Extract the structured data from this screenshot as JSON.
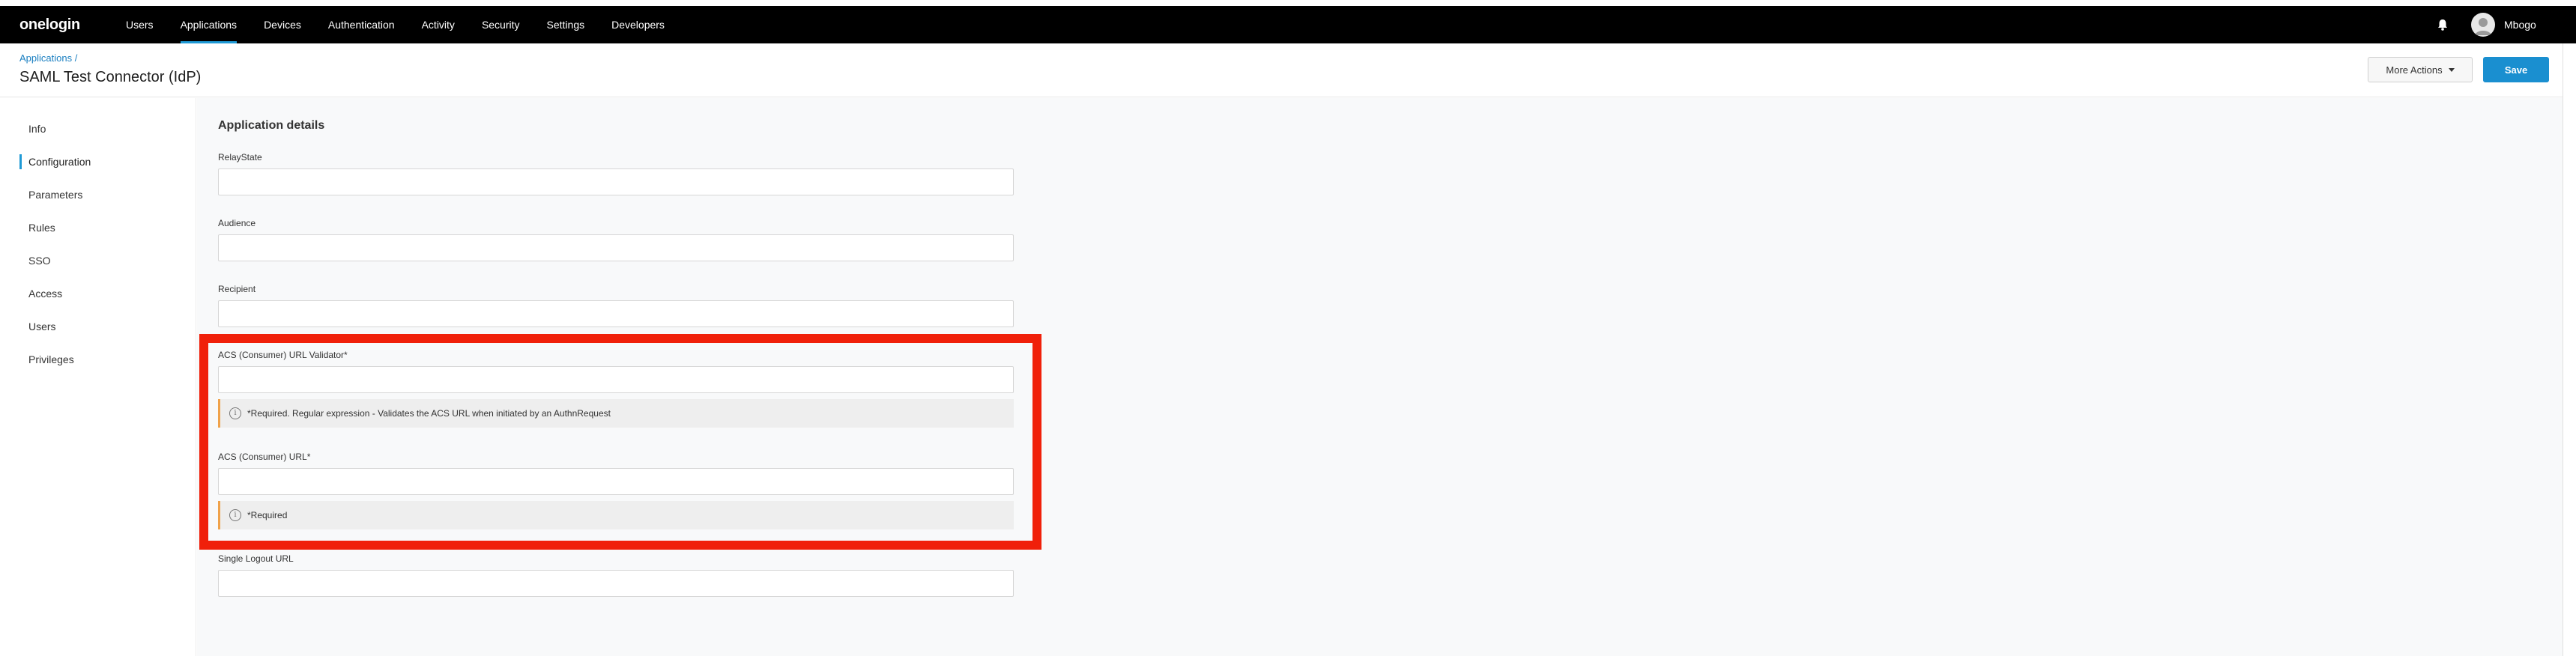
{
  "app": {
    "logo": "onelogin"
  },
  "nav": {
    "items": [
      {
        "label": "Users",
        "active": false
      },
      {
        "label": "Applications",
        "active": true
      },
      {
        "label": "Devices",
        "active": false
      },
      {
        "label": "Authentication",
        "active": false
      },
      {
        "label": "Activity",
        "active": false
      },
      {
        "label": "Security",
        "active": false
      },
      {
        "label": "Settings",
        "active": false
      },
      {
        "label": "Developers",
        "active": false
      }
    ],
    "user": "Mbogo"
  },
  "header": {
    "breadcrumb": "Applications",
    "breadcrumb_sep": "/",
    "title": "SAML Test Connector (IdP)",
    "more_actions": "More Actions",
    "save": "Save"
  },
  "sidebar": {
    "items": [
      {
        "label": "Info"
      },
      {
        "label": "Configuration"
      },
      {
        "label": "Parameters"
      },
      {
        "label": "Rules"
      },
      {
        "label": "SSO"
      },
      {
        "label": "Access"
      },
      {
        "label": "Users"
      },
      {
        "label": "Privileges"
      }
    ]
  },
  "form": {
    "section_title": "Application details",
    "fields": [
      {
        "label": "RelayState",
        "value": ""
      },
      {
        "label": "Audience",
        "value": ""
      },
      {
        "label": "Recipient",
        "value": ""
      },
      {
        "label": "ACS (Consumer) URL Validator*",
        "value": "",
        "hint": "*Required. Regular expression - Validates the ACS URL when initiated by an AuthnRequest"
      },
      {
        "label": "ACS (Consumer) URL*",
        "value": "",
        "hint": "*Required"
      },
      {
        "label": "Single Logout URL",
        "value": ""
      }
    ]
  },
  "colors": {
    "topbar": "#000000",
    "accent": "#1f9ad6",
    "save_button": "#1a8fd0",
    "highlight": "#f0200a",
    "hint_border": "#f0a24a"
  }
}
